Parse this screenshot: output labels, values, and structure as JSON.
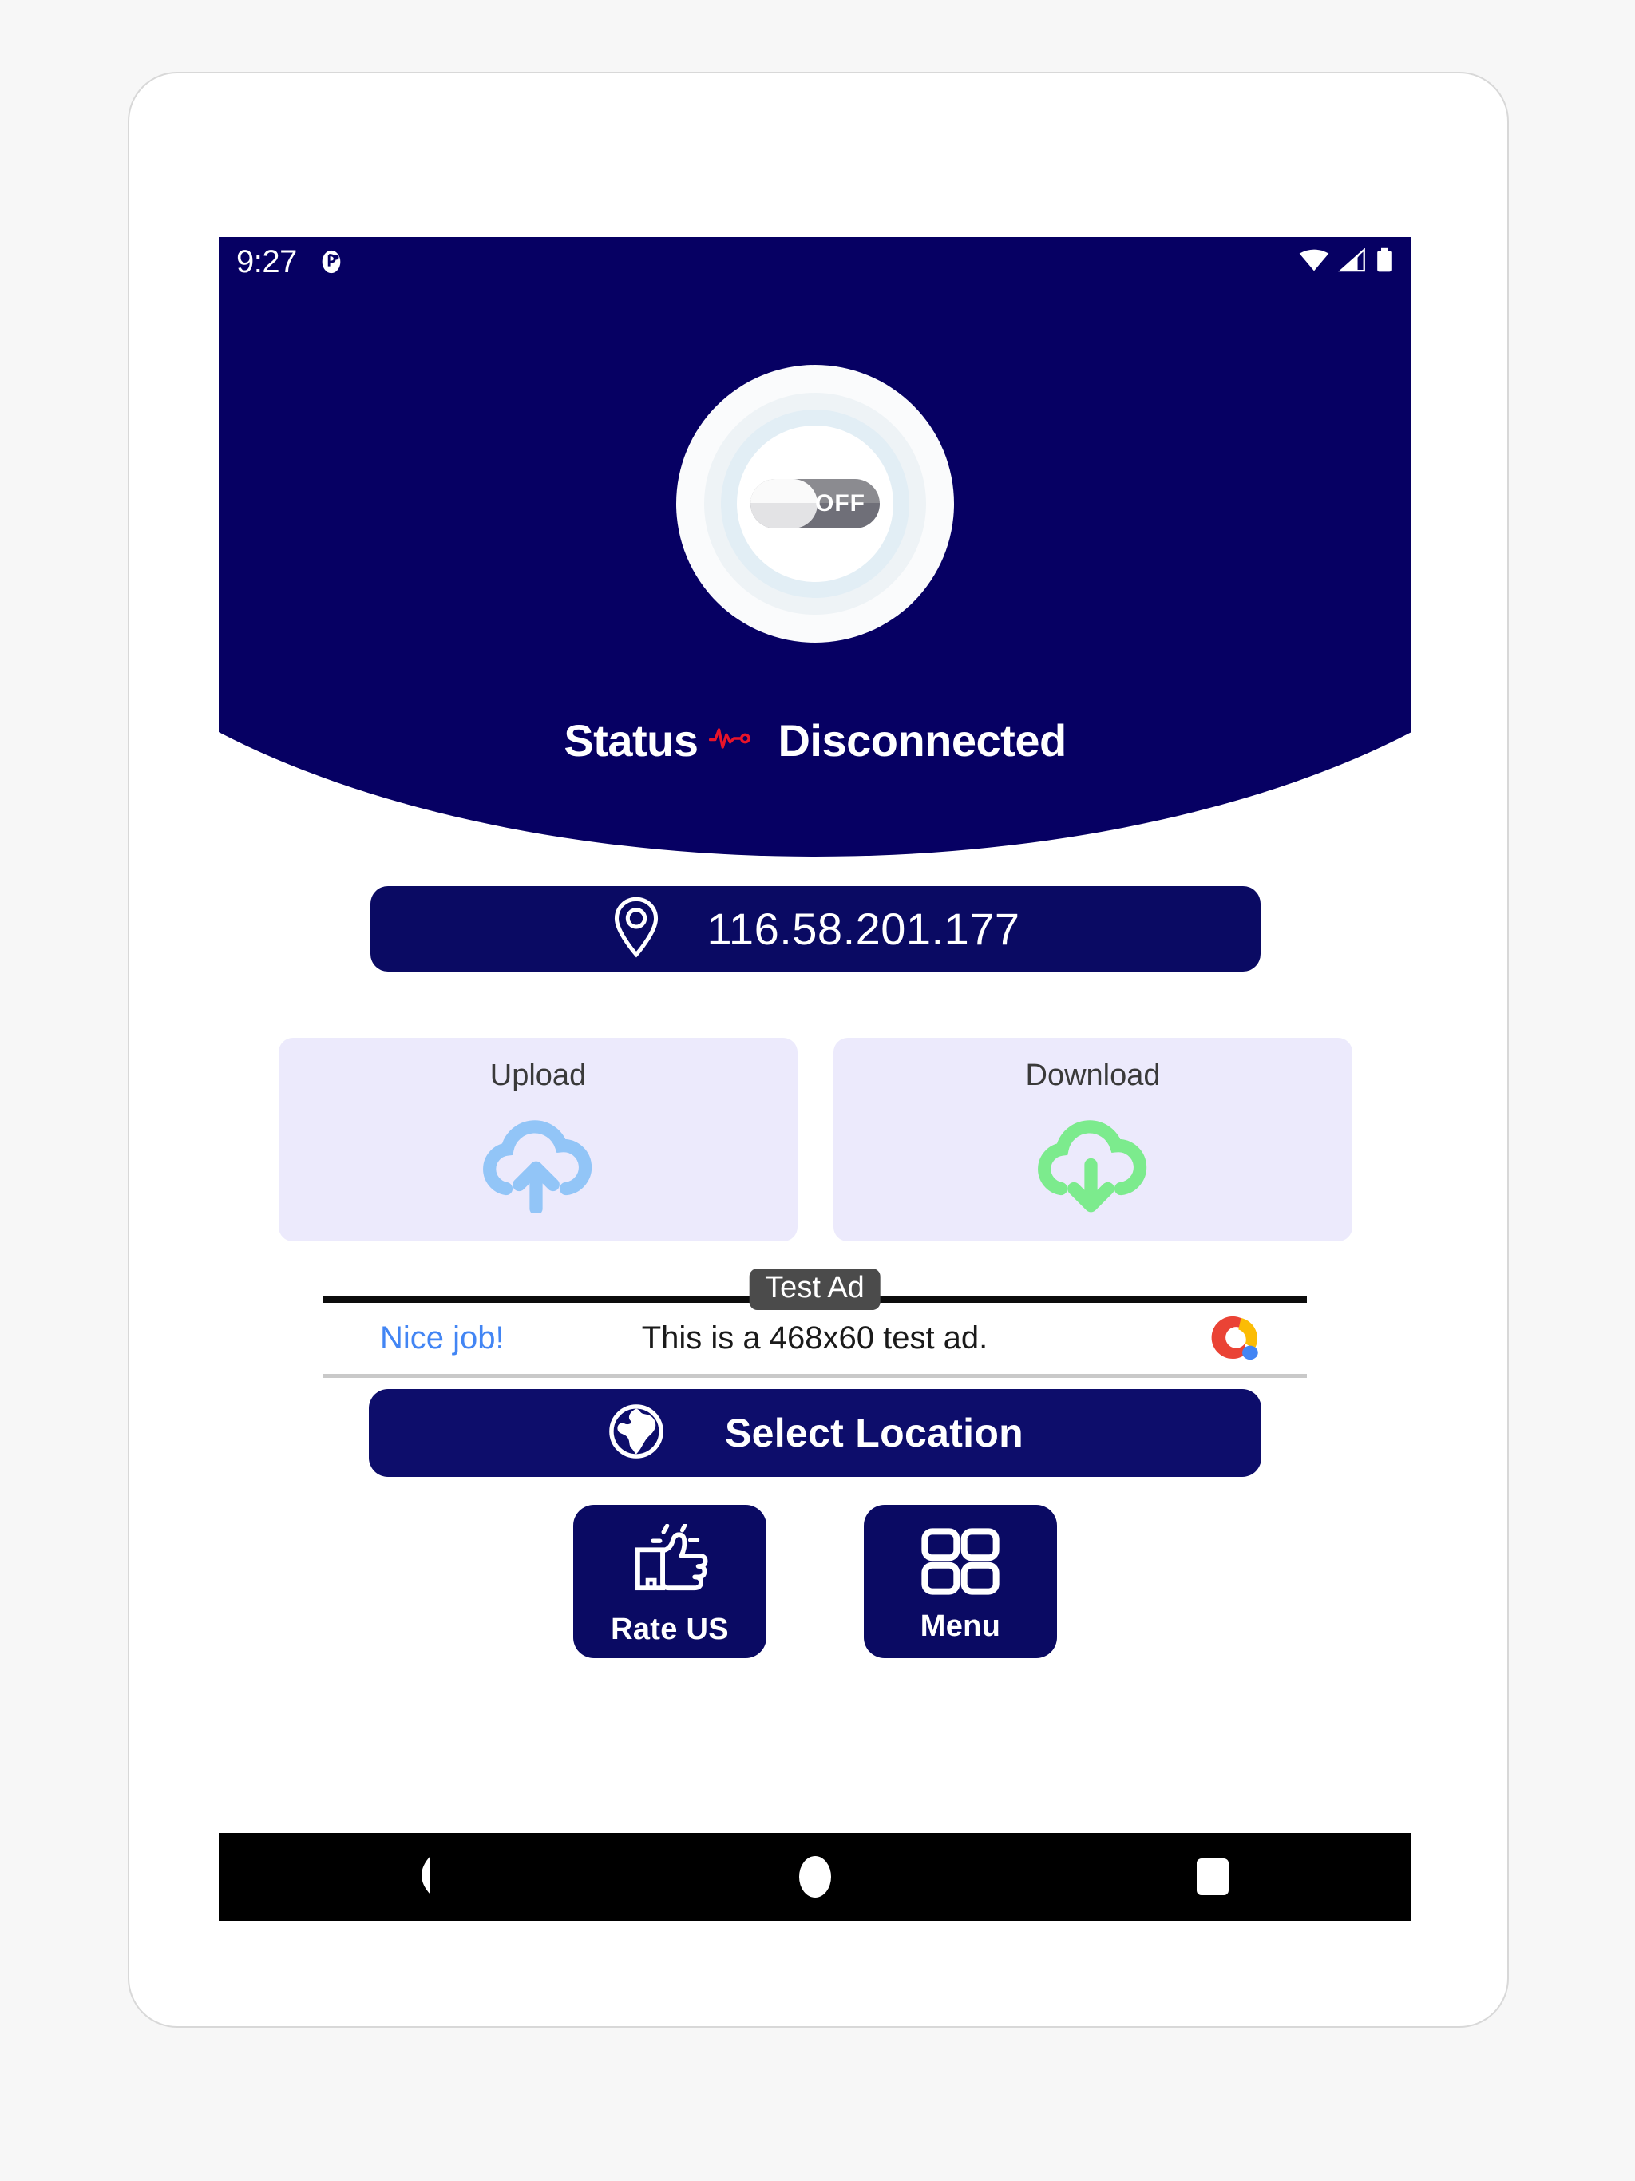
{
  "status_bar": {
    "time": "9:27",
    "left_icon": "notification-icon",
    "right_icons": [
      "wifi-icon",
      "cellular-signal-icon",
      "battery-icon"
    ]
  },
  "header": {
    "background_color": "#060063",
    "toggle": {
      "label": "OFF",
      "state": "off",
      "name": "vpn-power-toggle"
    },
    "status": {
      "prefix": "Status",
      "separator_icon": "heartbeat-pulse-icon",
      "separator_color": "#e8142a",
      "value": "Disconnected"
    }
  },
  "ip_button": {
    "icon": "location-pin-icon",
    "address": "116.58.201.177",
    "background_color": "#0a0a63"
  },
  "speed_cards": [
    {
      "label": "Upload",
      "icon": "cloud-upload-icon",
      "icon_color": "#92c5f7",
      "background_color": "#eceafc"
    },
    {
      "label": "Download",
      "icon": "cloud-download-icon",
      "icon_color": "#7ceb8d",
      "background_color": "#eceafc"
    }
  ],
  "ad": {
    "badge": "Test Ad",
    "headline": "Nice job!",
    "headline_color": "#4285f4",
    "body": "This is a 468x60 test ad.",
    "logo": "admob-logo-icon",
    "logo_colors": [
      "#ea4335",
      "#fbbc04",
      "#4285f4"
    ]
  },
  "select_location": {
    "label": "Select Location",
    "icon": "globe-icon",
    "background_color": "#0d0d6b"
  },
  "actions": [
    {
      "label": "Rate US",
      "icon": "thumbs-up-icon",
      "background_color": "#0a0a63"
    },
    {
      "label": "Menu",
      "icon": "grid-menu-icon",
      "background_color": "#0a0a63"
    }
  ],
  "nav_bar": {
    "back": "back-triangle-icon",
    "home": "home-circle-icon",
    "recents": "recents-square-icon"
  }
}
